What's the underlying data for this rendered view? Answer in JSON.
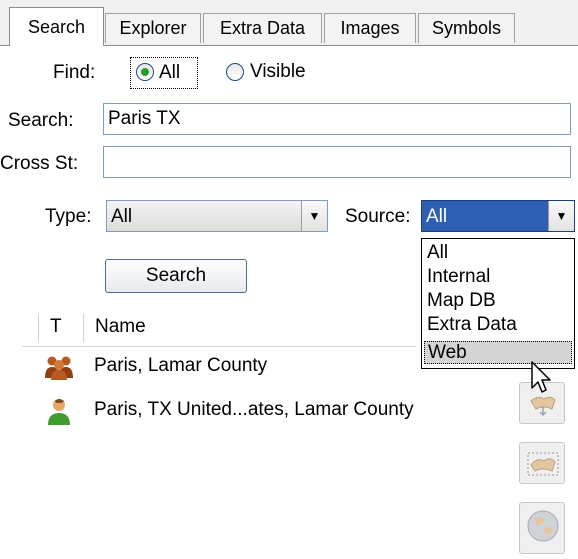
{
  "tabs": [
    {
      "label": "Search",
      "active": true
    },
    {
      "label": "Explorer",
      "active": false
    },
    {
      "label": "Extra Data",
      "active": false
    },
    {
      "label": "Images",
      "active": false
    },
    {
      "label": "Symbols",
      "active": false
    }
  ],
  "find": {
    "label": "Find:",
    "options": [
      {
        "label": "All",
        "selected": true
      },
      {
        "label": "Visible",
        "selected": false
      }
    ]
  },
  "search": {
    "label": "Search:",
    "value": "Paris TX"
  },
  "cross_street": {
    "label": "Cross St:",
    "value": ""
  },
  "type": {
    "label": "Type:",
    "value": "All"
  },
  "source": {
    "label": "Source:",
    "value": "All",
    "options": [
      "All",
      "Internal",
      "Map DB",
      "Extra Data",
      "Web"
    ],
    "hovered": "Web"
  },
  "search_button": {
    "label": "Search"
  },
  "results": {
    "columns": [
      "T",
      "Name"
    ],
    "rows": [
      {
        "icon": "group-icon",
        "name": "Paris, Lamar County"
      },
      {
        "icon": "person-icon",
        "name": "Paris, TX United...ates, Lamar County"
      }
    ]
  },
  "colors": {
    "selection": "#2d5fb3",
    "radio_dot": "#21a121",
    "group_icon": "#b85a1f",
    "person_icon": "#3f9c2e"
  }
}
